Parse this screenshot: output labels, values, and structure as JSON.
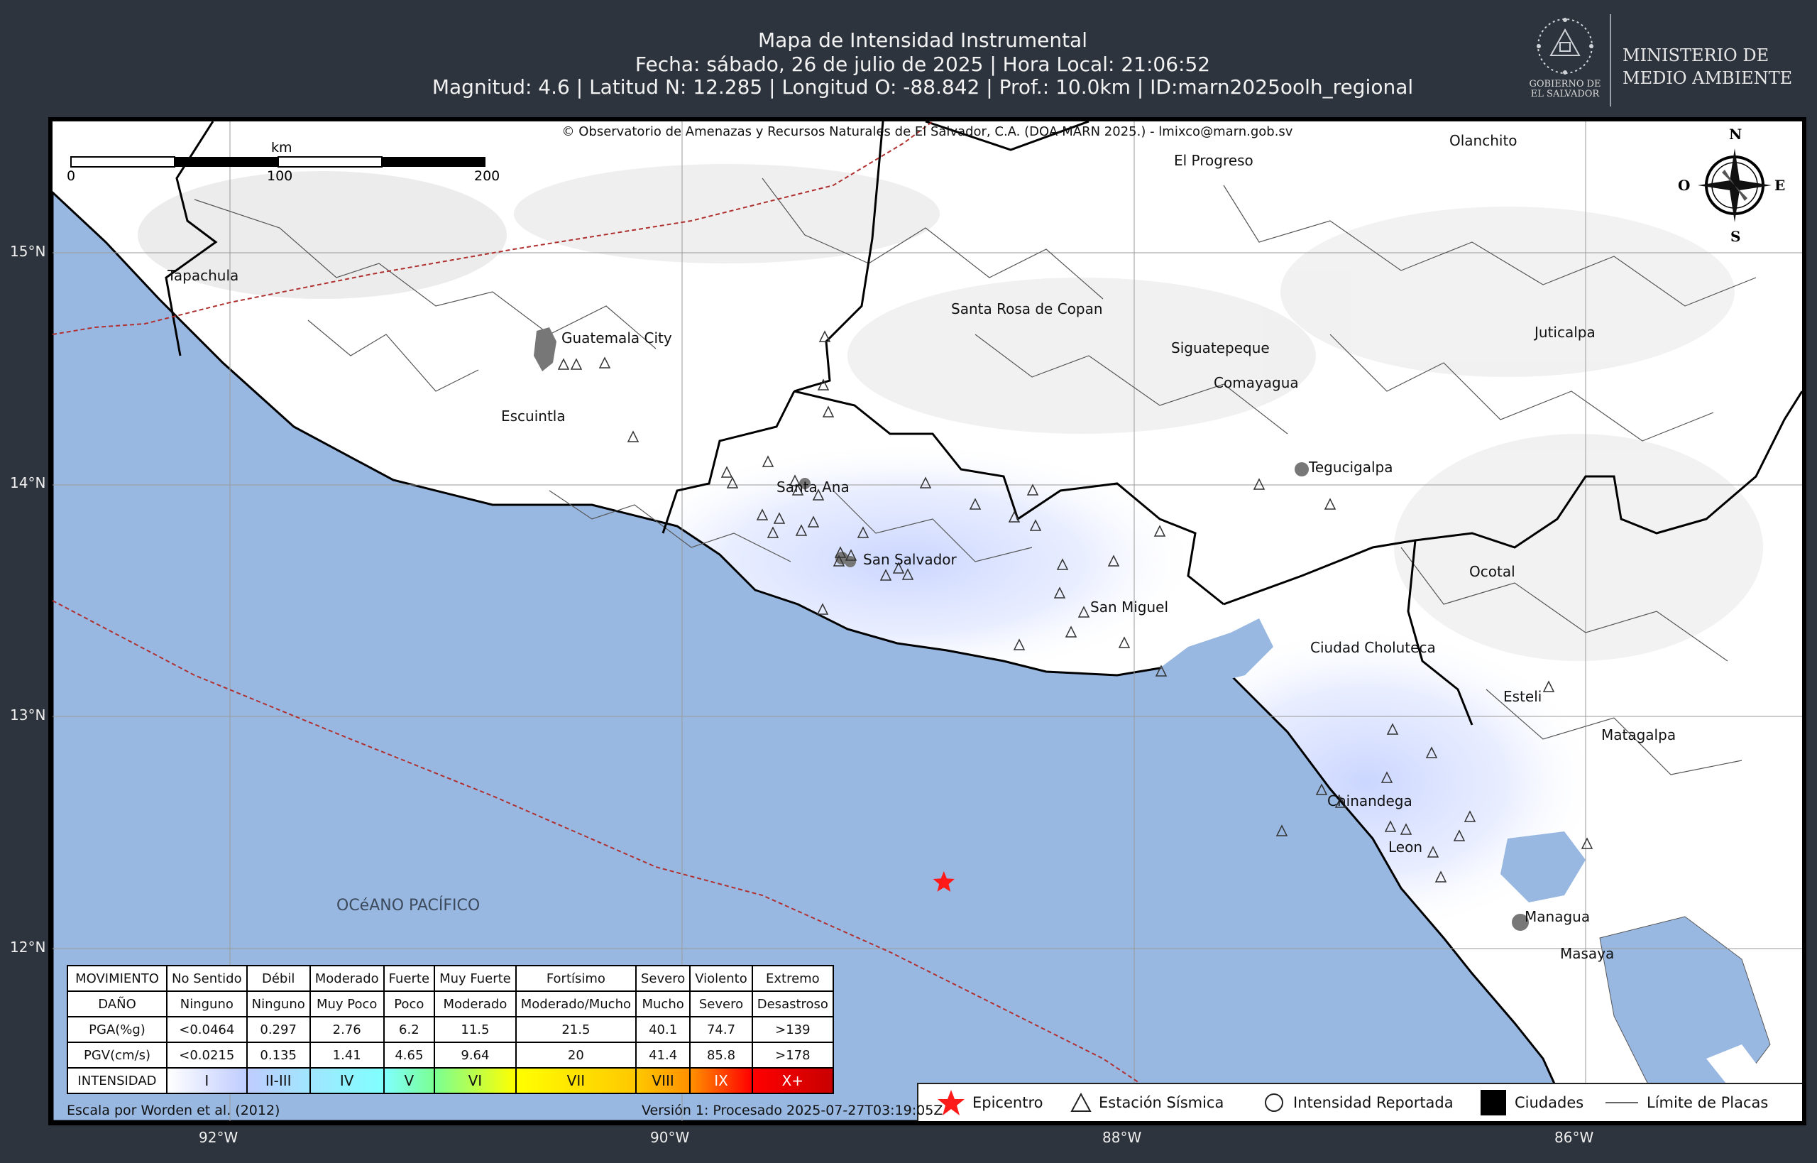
{
  "header": {
    "title": "Mapa de Intensidad Instrumental",
    "line2": "Fecha: sábado, 26 de julio de 2025 | Hora Local: 21:06:52",
    "line3": "Magnitud: 4.6 | Latitud N: 12.285 | Longitud O: -88.842 | Prof.: 10.0km | ID:marn2025oolh_regional"
  },
  "logo": {
    "gov_line1": "GOBIERNO DE",
    "gov_line2": "EL SALVADOR",
    "ministry_line1": "MINISTERIO DE",
    "ministry_line2": "MEDIO AMBIENTE"
  },
  "map": {
    "copyright": "© Observatorio de Amenazas y Recursos Naturales de El Salvador, C.A. (DOA-MARN 2025.) - lmixco@marn.gob.sv",
    "scale": {
      "unit": "km",
      "ticks": [
        "0",
        "100",
        "200"
      ]
    },
    "compass": {
      "north": "N",
      "south": "S",
      "east": "E",
      "west": "O"
    },
    "ocean_label": "OCéANO PACÍFICO",
    "places": [
      "Tapachula",
      "Guatemala City",
      "Escuintla",
      "Santa Ana",
      "San Salvador",
      "San Miguel",
      "Santa Rosa de Copan",
      "El Progreso",
      "Olanchito",
      "Siguatepeque",
      "Comayagua",
      "Juticalpa",
      "Tegucigalpa",
      "Ocotal",
      "Ciudad Choluteca",
      "Esteli",
      "Matagalpa",
      "Chinandega",
      "Leon",
      "Managua",
      "Masaya"
    ],
    "lon_ticks": [
      "92°W",
      "90°W",
      "88°W",
      "86°W"
    ],
    "lat_ticks": [
      "15°N",
      "14°N",
      "13°N",
      "12°N"
    ],
    "epicenter": {
      "lat": 12.285,
      "lon": -88.842,
      "color": "#ff1a1a"
    }
  },
  "intensity_table": {
    "rows": [
      {
        "label": "MOVIMIENTO",
        "cells": [
          "No Sentido",
          "Débil",
          "Moderado",
          "Fuerte",
          "Muy Fuerte",
          "Fortísimo",
          "Severo",
          "Violento",
          "Extremo"
        ]
      },
      {
        "label": "DAÑO",
        "cells": [
          "Ninguno",
          "Ninguno",
          "Muy Poco",
          "Poco",
          "Moderado",
          "Moderado/Mucho",
          "Mucho",
          "Severo",
          "Desastroso"
        ]
      },
      {
        "label": "PGA(%g)",
        "cells": [
          "<0.0464",
          "0.297",
          "2.76",
          "6.2",
          "11.5",
          "21.5",
          "40.1",
          "74.7",
          ">139"
        ]
      },
      {
        "label": "PGV(cm/s)",
        "cells": [
          "<0.0215",
          "0.135",
          "1.41",
          "4.65",
          "9.64",
          "20",
          "41.4",
          "85.8",
          ">178"
        ]
      }
    ],
    "intensity_label": "INTENSIDAD",
    "intensities": [
      "I",
      "II-III",
      "IV",
      "V",
      "VI",
      "VII",
      "VIII",
      "IX",
      "X+"
    ],
    "intensity_colors": [
      "#ffffff",
      "#bfccff",
      "#a0e6ff",
      "#80ffff",
      "#7aff93",
      "#ffff00",
      "#ffc800",
      "#ff9100",
      "#ff0000",
      "#c80000"
    ]
  },
  "legend": {
    "epicentro": "Epicentro",
    "estacion": "Estación Sísmica",
    "intensidad": "Intensidad Reportada",
    "ciudades": "Ciudades",
    "limite": "Límite de Placas"
  },
  "footer": {
    "worden": "Escala por Worden et al. (2012)",
    "version": "Versión 1: Procesado 2025-07-27T03:19:05Z"
  },
  "colors": {
    "ocean": "#98b8e2",
    "background": "#2e343d",
    "plate_boundary": "#b03030"
  }
}
